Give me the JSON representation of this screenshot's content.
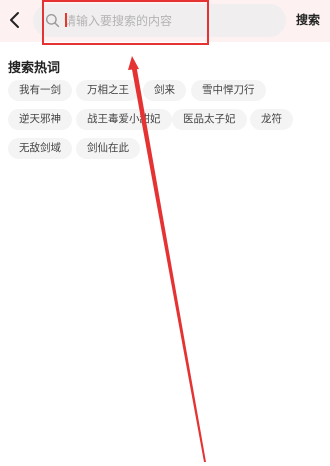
{
  "header": {
    "back_icon": "chevron-left-icon",
    "search_icon": "search-icon",
    "search_placeholder": "请输入要搜索的内容",
    "search_value": "",
    "search_button_label": "搜索"
  },
  "hot_search": {
    "title": "搜索热词",
    "items": [
      {
        "label": "我有一剑"
      },
      {
        "label": "万相之王"
      },
      {
        "label": "剑来"
      },
      {
        "label": "雪中悍刀行"
      },
      {
        "label": "逆天邪神"
      },
      {
        "label": "战王毒爱小甜妃"
      },
      {
        "label": "医品太子妃"
      },
      {
        "label": "龙符"
      },
      {
        "label": "无敌剑域"
      },
      {
        "label": "剑仙在此"
      }
    ]
  },
  "annotation": {
    "color": "#e53333"
  }
}
